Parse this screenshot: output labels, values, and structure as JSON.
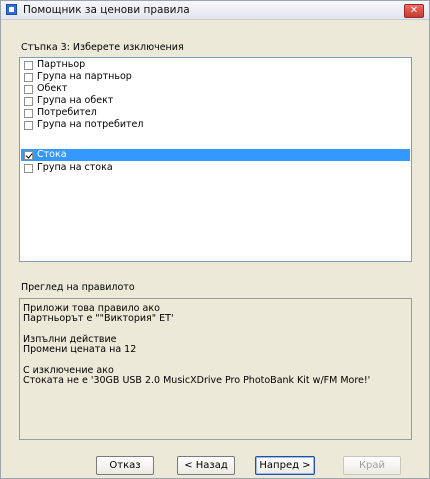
{
  "window": {
    "title": "Помощник за ценови правила",
    "close_glyph": "✕"
  },
  "step": {
    "label": "Стъпка 3: Изберете изключения"
  },
  "exceptions": {
    "items": [
      {
        "label": "Партньор",
        "checked": false,
        "selected": false
      },
      {
        "label": "Група на партньор",
        "checked": false,
        "selected": false
      },
      {
        "label": "Обект",
        "checked": false,
        "selected": false
      },
      {
        "label": "Група на обект",
        "checked": false,
        "selected": false
      },
      {
        "label": "Потребител",
        "checked": false,
        "selected": false
      },
      {
        "label": "Група на потребител",
        "checked": false,
        "selected": false
      },
      {
        "label": "Стока",
        "checked": true,
        "selected": true
      },
      {
        "label": "Група на стока",
        "checked": false,
        "selected": false
      }
    ]
  },
  "review": {
    "label": "Преглед на правилото",
    "lines": {
      "l1": "Приложи това правило ако",
      "l2": "Партньорът  е \"\"Виктория\" ЕТ'",
      "l3": "Изпълни действие",
      "l4": "Промени цената на 12",
      "l5": "С изключение ако",
      "l6": "Стоката не  е '30GB USB 2.0 MusicXDrive Pro PhotoBank Kit w/FM  More!'"
    }
  },
  "buttons": {
    "cancel": "Отказ",
    "back": "< Назад",
    "next": "Напред >",
    "finish": "Край"
  },
  "colors": {
    "selection": "#3399ff",
    "dialog_bg": "#ece9d8"
  }
}
